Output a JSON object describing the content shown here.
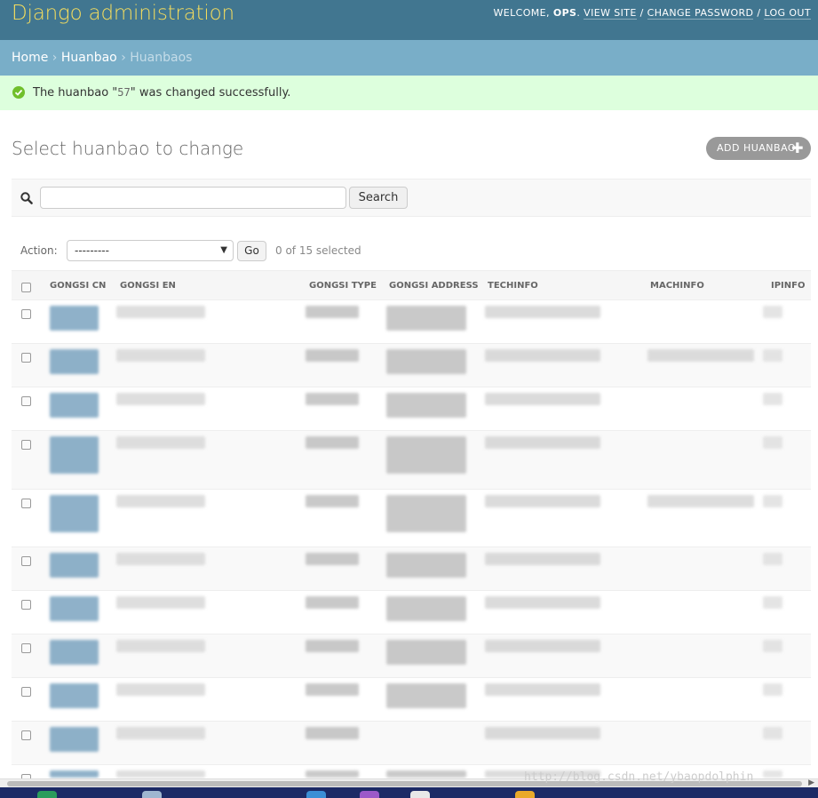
{
  "header": {
    "site_name": "Django administration",
    "welcome": "WELCOME,",
    "username": "OPS",
    "view_site": "VIEW SITE",
    "change_password": "CHANGE PASSWORD",
    "logout": "LOG OUT",
    "sep": "/"
  },
  "breadcrumbs": {
    "home": "Home",
    "app": "Huanbao",
    "current": "Huanbaos",
    "sep": "›"
  },
  "message": {
    "before": "The huanbao \"",
    "code": "57",
    "after": "\" was changed successfully."
  },
  "page": {
    "title": "Select huanbao to change",
    "add_button": "ADD HUANBAO"
  },
  "search": {
    "button": "Search",
    "value": "",
    "placeholder": ""
  },
  "actions": {
    "label": "Action:",
    "selected_option": "---------",
    "go": "Go",
    "counter": "0 of 15 selected"
  },
  "table": {
    "columns": [
      "GONGSI CN",
      "GONGSI EN",
      "GONGSI TYPE",
      "GONGSI ADDRESS",
      "TECHINFO",
      "MACHINFO",
      "IPINFO"
    ]
  },
  "colors": {
    "header_bg": "#417690",
    "site_name": "#f5dd5d",
    "breadcrumbs_bg": "#79aec8",
    "success_bg": "#ddffdd",
    "success_icon": "#70bf2b"
  },
  "footer": {
    "watermark": "http://blog.csdn.net/ybaopdolphin"
  }
}
